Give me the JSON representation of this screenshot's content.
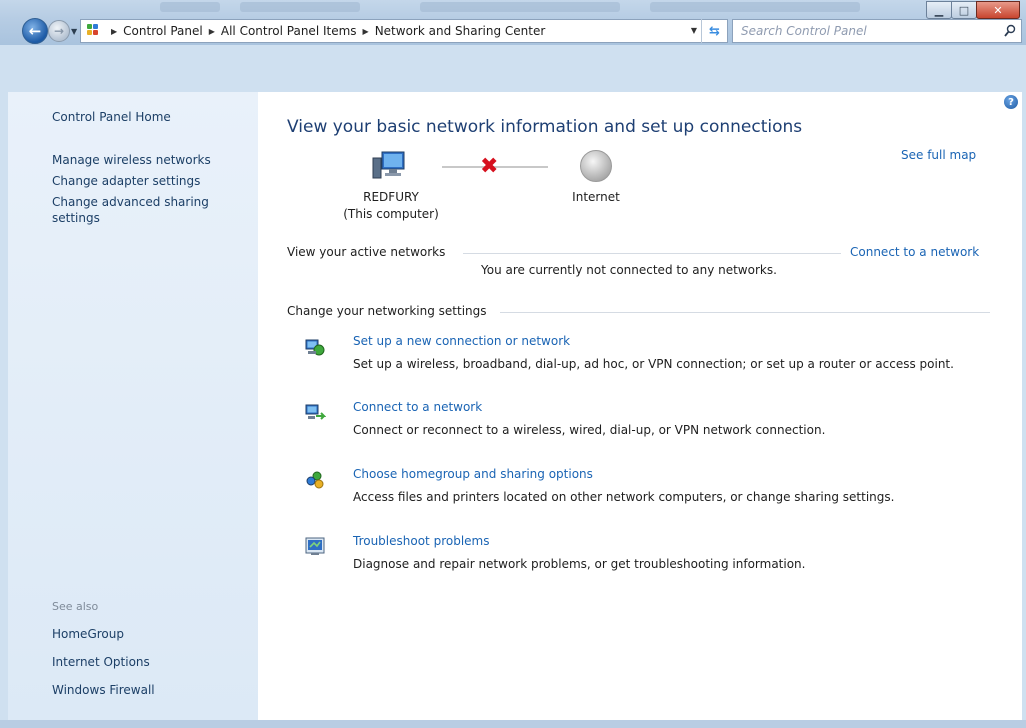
{
  "window": {
    "address": {
      "crumbs": [
        "Control Panel",
        "All Control Panel Items",
        "Network and Sharing Center"
      ]
    },
    "search_placeholder": "Search Control Panel"
  },
  "sidebar": {
    "home": "Control Panel Home",
    "links": [
      "Manage wireless networks",
      "Change adapter settings",
      "Change advanced sharing settings"
    ],
    "see_also_label": "See also",
    "see_also": [
      "HomeGroup",
      "Internet Options",
      "Windows Firewall"
    ]
  },
  "main": {
    "title": "View your basic network information and set up connections",
    "see_full_map": "See full map",
    "map": {
      "computer_name": "REDFURY",
      "computer_sub": "(This computer)",
      "internet": "Internet"
    },
    "active_networks": {
      "label": "View your active networks",
      "connect_link": "Connect to a network",
      "message": "You are currently not connected to any networks."
    },
    "settings_label": "Change your networking settings",
    "tasks": [
      {
        "icon": "new-connection-icon",
        "title": "Set up a new connection or network",
        "desc": "Set up a wireless, broadband, dial-up, ad hoc, or VPN connection; or set up a router or access point."
      },
      {
        "icon": "connect-network-icon",
        "title": "Connect to a network",
        "desc": "Connect or reconnect to a wireless, wired, dial-up, or VPN network connection."
      },
      {
        "icon": "homegroup-icon",
        "title": "Choose homegroup and sharing options",
        "desc": "Access files and printers located on other network computers, or change sharing settings."
      },
      {
        "icon": "troubleshoot-icon",
        "title": "Troubleshoot problems",
        "desc": "Diagnose and repair network problems, or get troubleshooting information."
      }
    ]
  },
  "colors": {
    "link": "#1a64b4",
    "title": "#1e3f73",
    "sidebar_link": "#1c3f66",
    "disconnect_x": "#d6101e"
  }
}
